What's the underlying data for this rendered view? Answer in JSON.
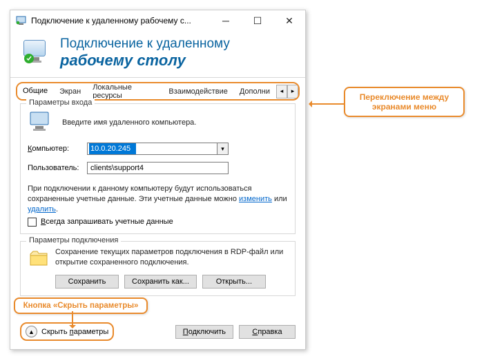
{
  "titlebar": {
    "title": "Подключение к удаленному рабочему с..."
  },
  "header": {
    "line1": "Подключение к удаленному",
    "line2": "рабочему столу"
  },
  "tabs": {
    "items": [
      "Общие",
      "Экран",
      "Локальные ресурсы",
      "Взаимодействие",
      "Дополни"
    ],
    "active_index": 0
  },
  "login": {
    "legend": "Параметры входа",
    "hint": "Введите имя удаленного компьютера.",
    "computer_label_pre": "К",
    "computer_label_rest": "омпьютер:",
    "computer_value": "10.0.20.245",
    "user_label": "Пользователь:",
    "user_value": "clients\\support4",
    "note_pre": "При подключении к данному компьютеру будут использоваться сохраненные учетные данные.  Эти учетные данные можно ",
    "link_change": "изменить",
    "note_mid": " или ",
    "link_delete": "удалить",
    "note_post": ".",
    "always_ask_pre": "В",
    "always_ask_rest": "сегда запрашивать учетные данные"
  },
  "conn": {
    "legend": "Параметры подключения",
    "text": "Сохранение текущих параметров подключения в RDP-файл или открытие сохраненного подключения.",
    "save": "Сохранить",
    "save_as": "Сохранить как...",
    "open": "Открыть..."
  },
  "footer": {
    "hide_pre": "Скрыть ",
    "hide_u": "п",
    "hide_rest": "араметры",
    "connect_pre": "П",
    "connect_rest": "одключить",
    "help_pre": "С",
    "help_rest": "правка"
  },
  "callouts": {
    "right": "Переключение между экранами меню",
    "left": "Кнопка «Скрыть параметры»"
  }
}
